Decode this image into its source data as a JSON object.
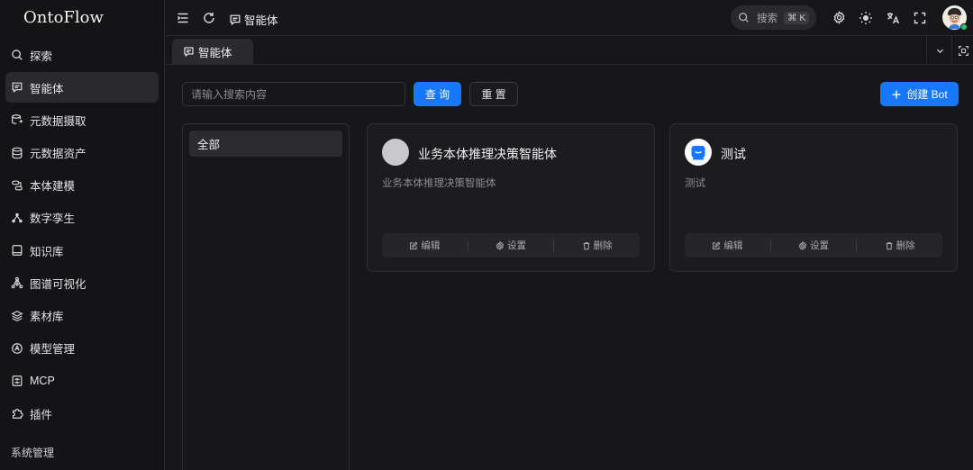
{
  "app": {
    "logo": "OntoFlow"
  },
  "sidebar": {
    "items": [
      {
        "label": "探索",
        "icon": "search-icon"
      },
      {
        "label": "智能体",
        "icon": "chat-bubble-icon"
      },
      {
        "label": "元数据摄取",
        "icon": "database-ingest-icon"
      },
      {
        "label": "元数据资产",
        "icon": "database-icon"
      },
      {
        "label": "本体建模",
        "icon": "model-icon"
      },
      {
        "label": "数字孪生",
        "icon": "network-icon"
      },
      {
        "label": "知识库",
        "icon": "book-icon"
      },
      {
        "label": "图谱可视化",
        "icon": "graph-icon"
      },
      {
        "label": "素材库",
        "icon": "layers-icon"
      },
      {
        "label": "模型管理",
        "icon": "model-badge-icon"
      },
      {
        "label": "MCP",
        "icon": "mcp-icon"
      },
      {
        "label": "插件",
        "icon": "puzzle-icon"
      }
    ],
    "active_index": 1,
    "section_label": "系统管理"
  },
  "header": {
    "breadcrumb": "智能体",
    "search_label": "搜索",
    "shortcut": "⌘ K"
  },
  "tabs": [
    {
      "label": "智能体"
    }
  ],
  "toolbar": {
    "search_placeholder": "请输入搜索内容",
    "query_label": "查 询",
    "reset_label": "重 置",
    "create_label": "创建 Bot"
  },
  "categories": [
    {
      "label": "全部"
    }
  ],
  "bots": [
    {
      "title": "业务本体推理决策智能体",
      "description": "业务本体推理决策智能体",
      "avatar": "placeholder"
    },
    {
      "title": "测试",
      "description": "测试",
      "avatar": "robot-icon"
    }
  ],
  "card_actions": {
    "edit": "编辑",
    "settings": "设置",
    "delete": "删除"
  },
  "colors": {
    "accent": "#1677ff",
    "background": "#17171a",
    "sidebar": "#141416",
    "online": "#2ec46a"
  }
}
